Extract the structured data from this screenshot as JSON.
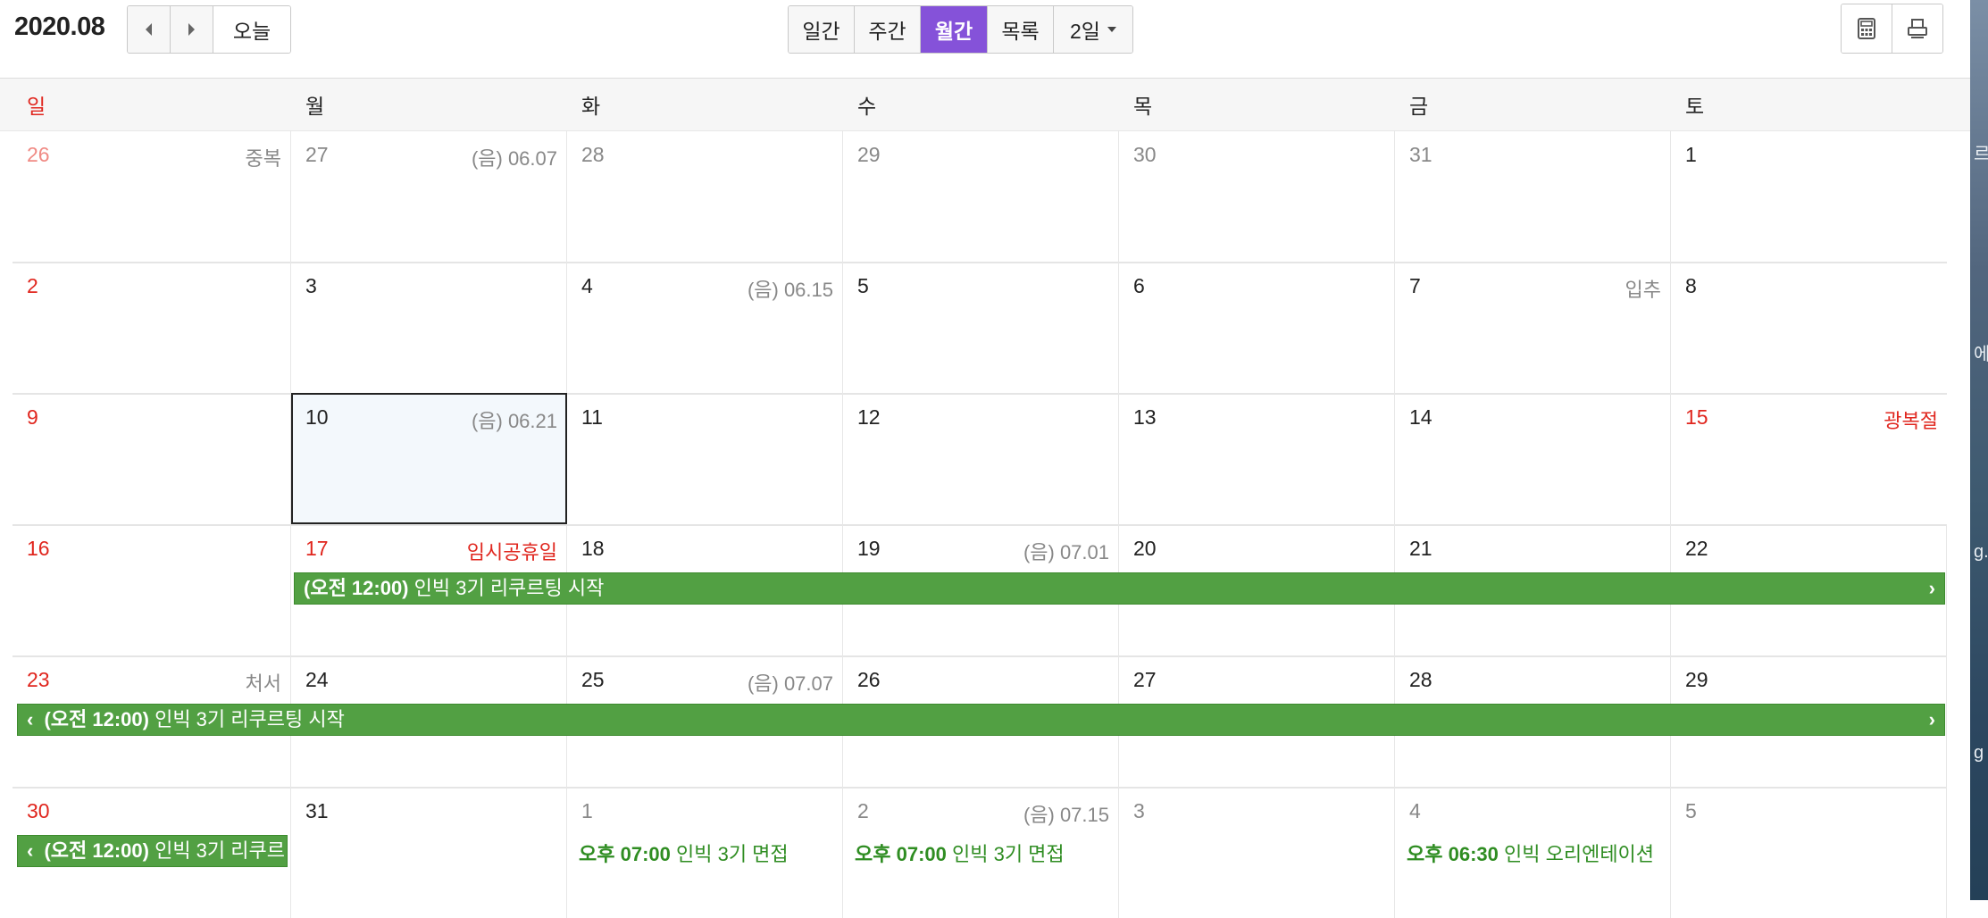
{
  "header": {
    "title": "2020.08",
    "today_label": "오늘",
    "views": [
      "일간",
      "주간",
      "월간",
      "목록",
      "2일"
    ],
    "active_view": "월간"
  },
  "weekdays": [
    "일",
    "월",
    "화",
    "수",
    "목",
    "금",
    "토"
  ],
  "weeks": [
    {
      "days": [
        {
          "num": "26",
          "note": "중복"
        },
        {
          "num": "27",
          "note": "(음) 06.07"
        },
        {
          "num": "28",
          "note": ""
        },
        {
          "num": "29",
          "note": ""
        },
        {
          "num": "30",
          "note": ""
        },
        {
          "num": "31",
          "note": ""
        },
        {
          "num": "1",
          "note": ""
        }
      ]
    },
    {
      "days": [
        {
          "num": "2",
          "note": ""
        },
        {
          "num": "3",
          "note": ""
        },
        {
          "num": "4",
          "note": "(음) 06.15"
        },
        {
          "num": "5",
          "note": ""
        },
        {
          "num": "6",
          "note": ""
        },
        {
          "num": "7",
          "note": "입추"
        },
        {
          "num": "8",
          "note": ""
        }
      ]
    },
    {
      "days": [
        {
          "num": "9",
          "note": ""
        },
        {
          "num": "10",
          "note": "(음) 06.21"
        },
        {
          "num": "11",
          "note": ""
        },
        {
          "num": "12",
          "note": ""
        },
        {
          "num": "13",
          "note": ""
        },
        {
          "num": "14",
          "note": ""
        },
        {
          "num": "15",
          "note": "광복절"
        }
      ]
    },
    {
      "days": [
        {
          "num": "16",
          "note": ""
        },
        {
          "num": "17",
          "note": "임시공휴일"
        },
        {
          "num": "18",
          "note": ""
        },
        {
          "num": "19",
          "note": "(음) 07.01"
        },
        {
          "num": "20",
          "note": ""
        },
        {
          "num": "21",
          "note": ""
        },
        {
          "num": "22",
          "note": ""
        }
      ]
    },
    {
      "days": [
        {
          "num": "23",
          "note": "처서"
        },
        {
          "num": "24",
          "note": ""
        },
        {
          "num": "25",
          "note": "(음) 07.07"
        },
        {
          "num": "26",
          "note": ""
        },
        {
          "num": "27",
          "note": ""
        },
        {
          "num": "28",
          "note": ""
        },
        {
          "num": "29",
          "note": ""
        }
      ]
    },
    {
      "days": [
        {
          "num": "30",
          "note": ""
        },
        {
          "num": "31",
          "note": ""
        },
        {
          "num": "1",
          "note": ""
        },
        {
          "num": "2",
          "note": "(음) 07.15"
        },
        {
          "num": "3",
          "note": ""
        },
        {
          "num": "4",
          "note": ""
        },
        {
          "num": "5",
          "note": ""
        }
      ]
    }
  ],
  "events": {
    "recruit_time": "(오전 12:00)",
    "recruit_title": "인빅 3기 리쿠르팅 시작",
    "recruit_title_cut": "인빅 3기 리쿠르",
    "interview1_time": "오후 07:00",
    "interview1_title": "인빅 3기 면접",
    "interview2_time": "오후 07:00",
    "interview2_title": "인빅 3기 면접",
    "orientation_time": "오후 06:30",
    "orientation_title": "인빅 오리엔테이션"
  },
  "colors": {
    "accent": "#8552d9",
    "event_green": "#52a043",
    "holiday_red": "#e0261e"
  },
  "background_strip": {
    "fragments": [
      "르",
      "에",
      "g.",
      "g"
    ]
  }
}
